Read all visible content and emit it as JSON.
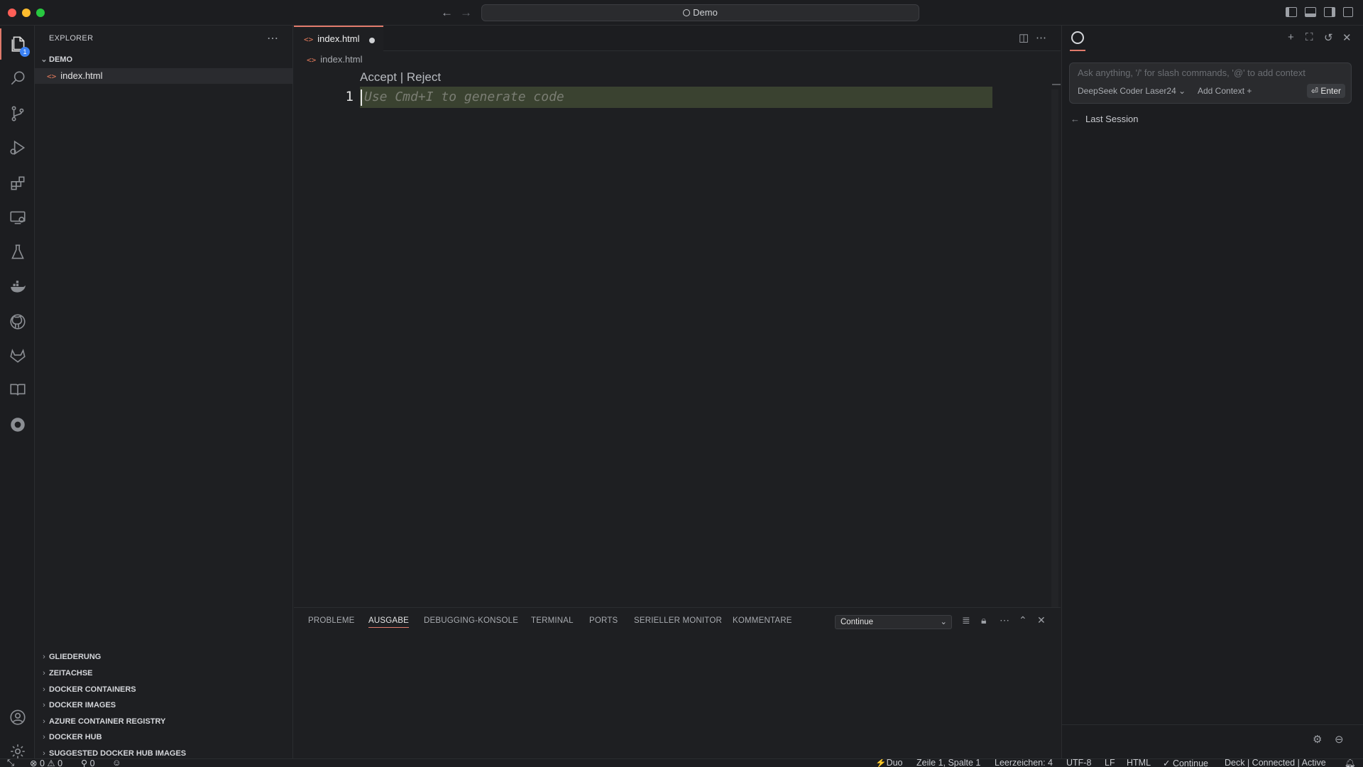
{
  "window": {
    "title": "Demo"
  },
  "sidebar": {
    "title": "EXPLORER",
    "folder": "DEMO",
    "file": "index.html",
    "sections": [
      "GLIEDERUNG",
      "ZEITACHSE",
      "DOCKER CONTAINERS",
      "DOCKER IMAGES",
      "AZURE CONTAINER REGISTRY",
      "DOCKER HUB",
      "SUGGESTED DOCKER HUB IMAGES"
    ]
  },
  "activity": {
    "explorer_badge": "1",
    "icons": [
      "files-icon",
      "search-icon",
      "source-control-icon",
      "run-debug-icon",
      "extensions-icon",
      "remote-explorer-icon",
      "testing-icon",
      "docker-icon",
      "github-icon",
      "gitlab-icon",
      "book-icon",
      "continue-icon",
      "account-icon",
      "settings-gear-icon"
    ]
  },
  "editor": {
    "tab_label": "index.html",
    "breadcrumb": "index.html",
    "accept_label": "Accept",
    "separator": "|",
    "reject_label": "Reject",
    "line_number": "1",
    "placeholder": "Use Cmd+I to generate code"
  },
  "panel": {
    "tabs": [
      "PROBLEME",
      "AUSGABE",
      "DEBUGGING-KONSOLE",
      "TERMINAL",
      "PORTS",
      "SERIELLER MONITOR",
      "KOMMENTARE"
    ],
    "active_tab": "AUSGABE",
    "channel": "Continue"
  },
  "chat": {
    "input_placeholder": "Ask anything, '/' for slash commands, '@' to add context",
    "model": "DeepSeek Coder Laser24",
    "add_context": "Add Context",
    "enter": "Enter",
    "last_session": "Last Session"
  },
  "statusbar": {
    "errors": "0",
    "warnings": "0",
    "ports": "0",
    "duo": "Duo",
    "position": "Zeile 1, Spalte 1",
    "spaces": "Leerzeichen: 4",
    "encoding": "UTF-8",
    "eol": "LF",
    "language": "HTML",
    "continue": "Continue",
    "deck": "Deck | Connected | Active"
  },
  "colors": {
    "accent": "#e07a6b",
    "background": "#1e1f22",
    "line_highlight": "#3a4230",
    "badge": "#3b82f6"
  }
}
